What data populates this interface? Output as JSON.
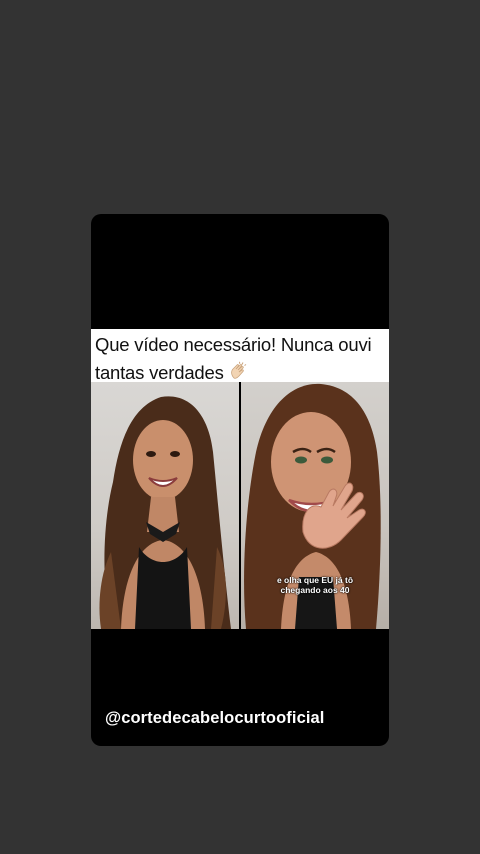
{
  "caption": {
    "text": "Que vídeo necessário! Nunca ouvi tantas verdades",
    "emoji_icon": "clapping-hands-icon"
  },
  "video": {
    "subtitle_line1": "e olha que EU já tô",
    "subtitle_line2": "chegando aos 40"
  },
  "handle": "@cortedecabelocurtooficial",
  "colors": {
    "background": "#333333",
    "card": "#000000",
    "caption_bg": "#ffffff"
  }
}
